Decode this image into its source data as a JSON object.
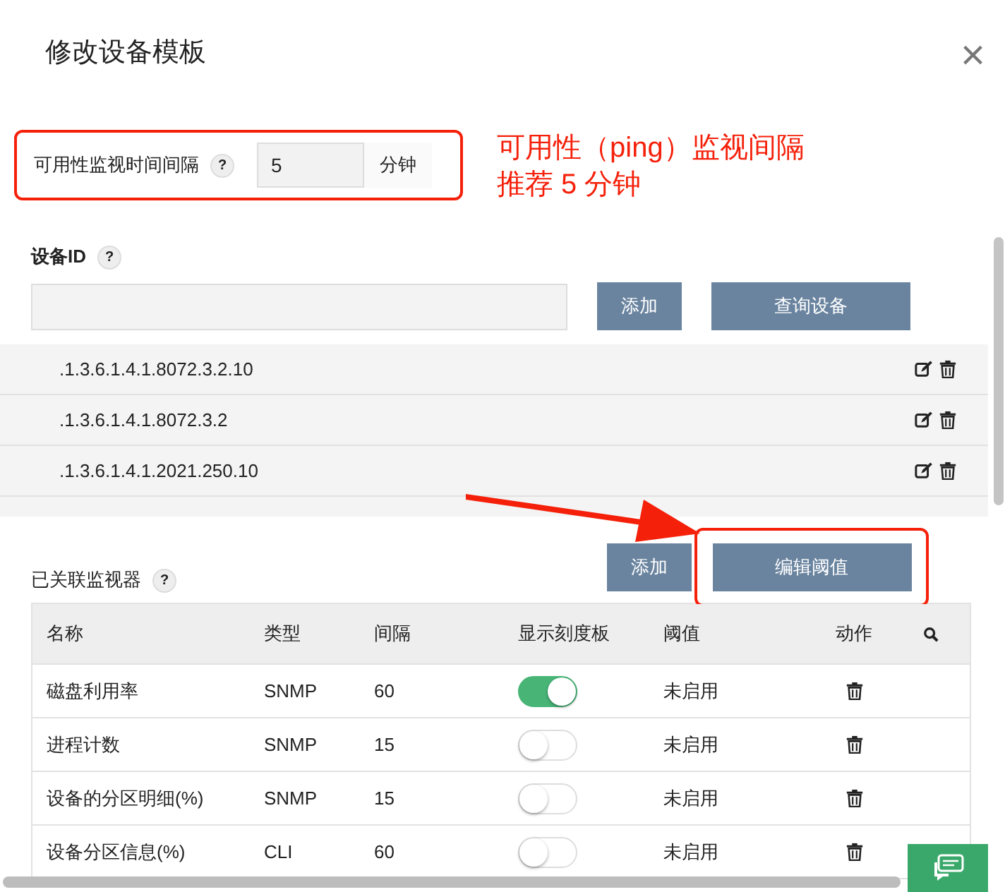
{
  "dialog": {
    "title": "修改设备模板",
    "close": "×"
  },
  "interval": {
    "label": "可用性监视时间间隔",
    "help": "?",
    "value": "5",
    "unit": "分钟",
    "highlighted": true
  },
  "annotation": [
    "可用性（ping）监视间隔",
    "推荐 5 分钟"
  ],
  "device_id": {
    "label": "设备ID",
    "help": "?",
    "buttons": [
      "添加",
      "查询设备"
    ],
    "oids": [
      ".1.3.6.1.4.1.8072.3.2.10",
      ".1.3.6.1.4.1.8072.3.2",
      ".1.3.6.1.4.1.2021.250.10"
    ]
  },
  "monitors": {
    "label": "已关联监视器",
    "help": "?",
    "buttons": [
      {
        "label": "添加",
        "highlighted": false
      },
      {
        "label": "编辑阈值",
        "highlighted": true
      }
    ],
    "columns": [
      "名称",
      "类型",
      "间隔",
      "显示刻度板",
      "阈值",
      "动作"
    ],
    "rows": [
      {
        "name": "磁盘利用率",
        "type": "SNMP",
        "interval": "60",
        "dashboard": true,
        "threshold": "未启用"
      },
      {
        "name": "进程计数",
        "type": "SNMP",
        "interval": "15",
        "dashboard": false,
        "threshold": "未启用"
      },
      {
        "name": "设备的分区明细(%)",
        "type": "SNMP",
        "interval": "15",
        "dashboard": false,
        "threshold": "未启用"
      },
      {
        "name": "设备分区信息(%)",
        "type": "CLI",
        "interval": "60",
        "dashboard": false,
        "threshold": "未启用"
      }
    ]
  }
}
